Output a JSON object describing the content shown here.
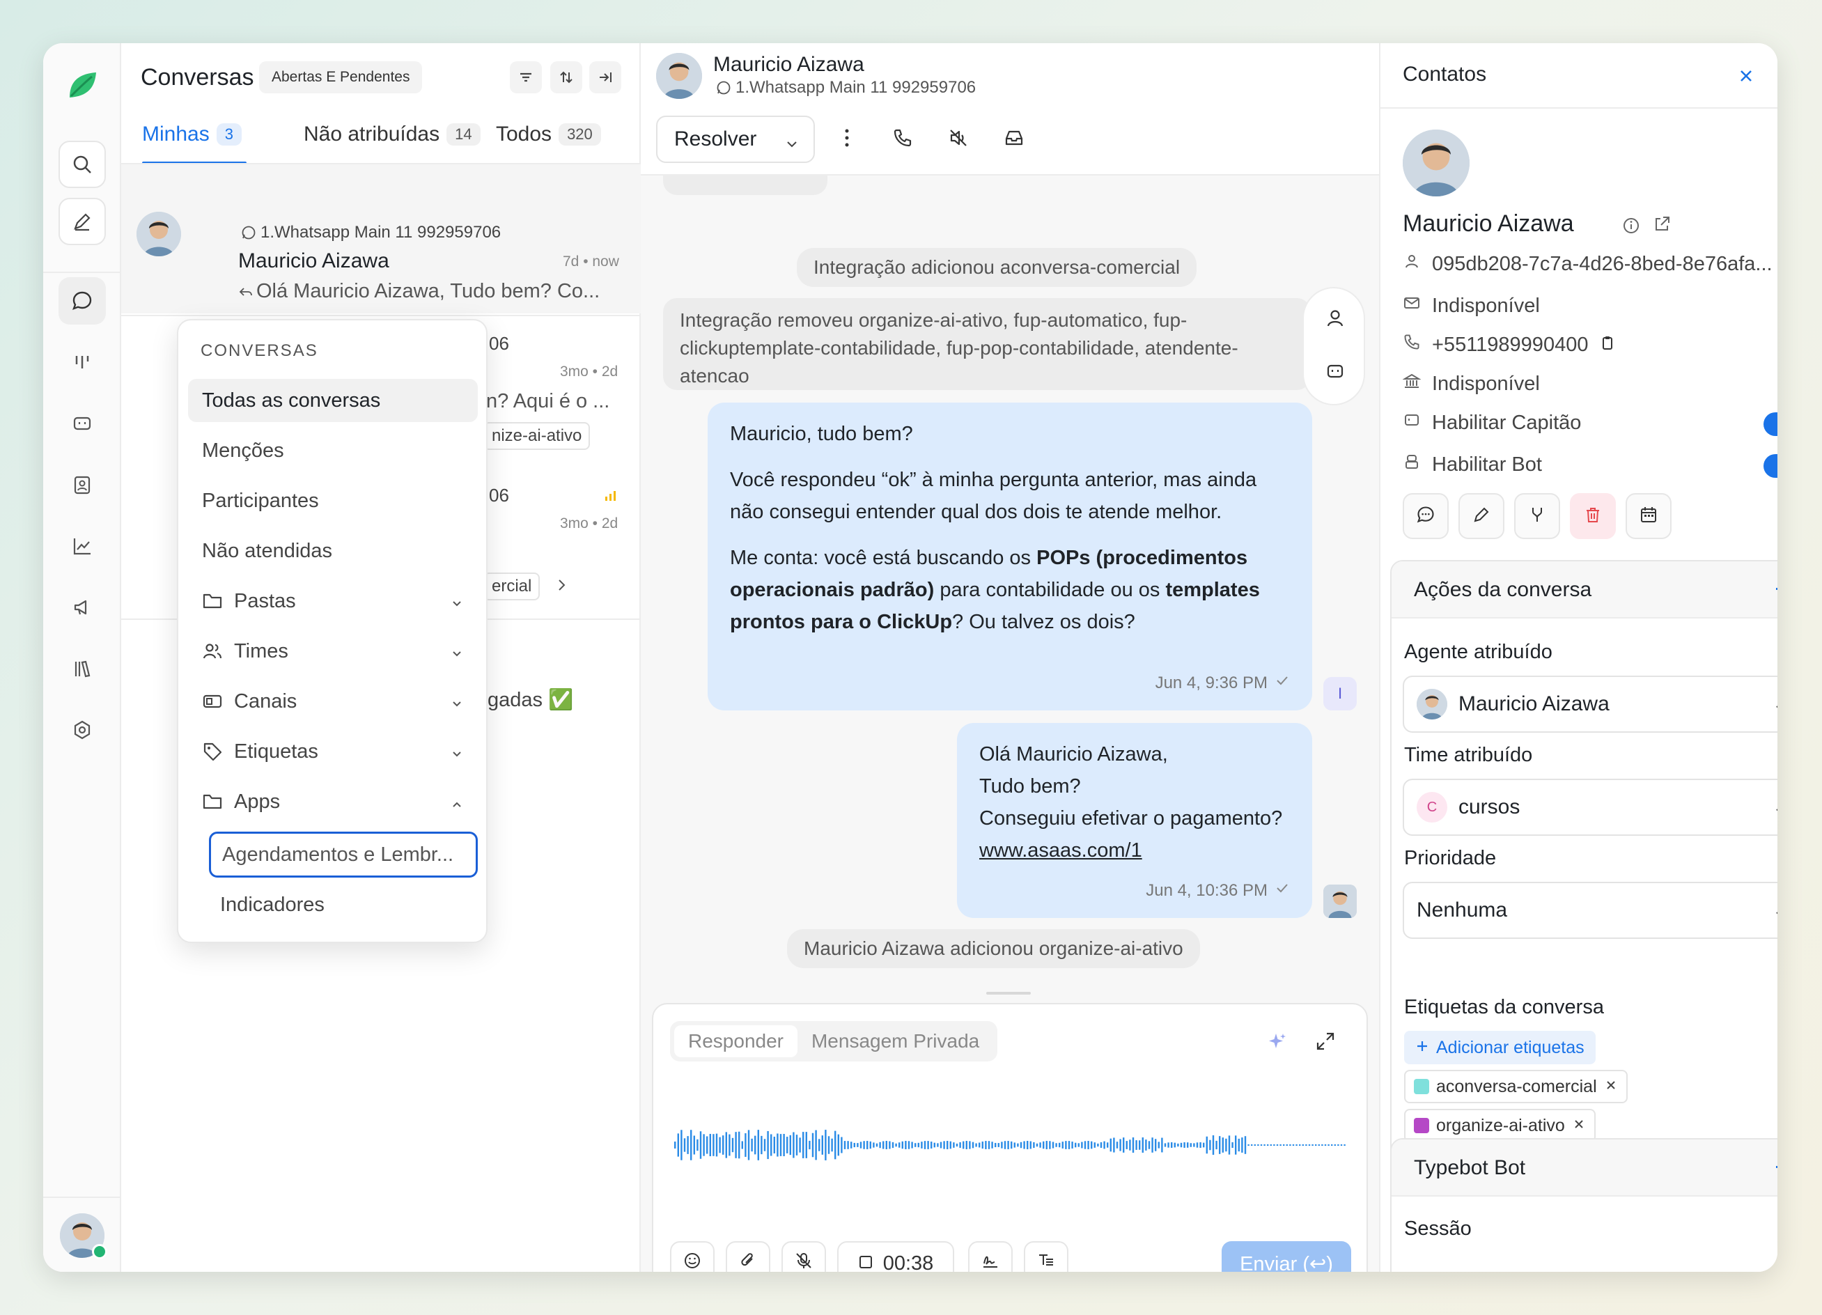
{
  "sidebar": {
    "icons": [
      "logo-leaf-icon",
      "search-icon",
      "compose-icon",
      "chat-icon",
      "kanban-icon",
      "bot-icon",
      "contacts-icon",
      "reports-icon",
      "campaigns-icon",
      "library-icon",
      "settings-icon"
    ]
  },
  "list": {
    "title": "Conversas",
    "status_filter": "Abertas E Pendentes",
    "tabs": [
      {
        "label": "Minhas",
        "count": "3"
      },
      {
        "label": "Não atribuídas",
        "count": "14"
      },
      {
        "label": "Todos",
        "count": "320"
      }
    ],
    "first": {
      "channel": "1.Whatsapp Main 11 992959706",
      "name": "Mauricio Aizawa",
      "time": "7d • now",
      "preview": "Olá Mauricio Aizawa, Tudo bem? Co..."
    },
    "second": {
      "channel_tail": "06",
      "time": "3mo • 2d",
      "preview_tail": "n? Aqui é o ...",
      "tag_tail": "nize-ai-ativo"
    },
    "third": {
      "channel_tail": "06",
      "time": "3mo • 2d",
      "tag_tail": "ercial"
    },
    "fourth": {
      "preview_tail": "gadas ✅"
    }
  },
  "menu": {
    "header": "CONVERSAS",
    "items": [
      {
        "label": "Todas as conversas"
      },
      {
        "label": "Menções"
      },
      {
        "label": "Participantes"
      },
      {
        "label": "Não atendidas"
      },
      {
        "label": "Pastas"
      },
      {
        "label": "Times"
      },
      {
        "label": "Canais"
      },
      {
        "label": "Etiquetas"
      },
      {
        "label": "Apps"
      },
      {
        "label": "Agendamentos e Lembr..."
      },
      {
        "label": "Indicadores"
      }
    ]
  },
  "chat": {
    "name": "Mauricio Aizawa",
    "channel": "1.Whatsapp Main 11 992959706",
    "resolve_label": "Resolver",
    "sys1": "Integração adicionou aconversa-comercial",
    "sys2": "Integração removeu organize-ai-ativo, fup-automatico, fup-clickuptemplate-contabilidade, fup-pop-contabilidade, atendente-atencao",
    "msg1": {
      "p1": "Mauricio, tudo bem?",
      "p2": "Você respondeu “ok” à minha pergunta anterior, mas ainda não consegui entender qual dos dois te atende melhor.",
      "p3_a": "Me conta: você está buscando os ",
      "p3_b": "POPs (procedimentos operacionais padrão)",
      "p3_c": " para contabilidade ou os ",
      "p3_d": "templates prontos para o ClickUp",
      "p3_e": "? Ou talvez os dois?",
      "time": "Jun 4, 9:36 PM",
      "avatar_initial": "I"
    },
    "msg2": {
      "l1": "Olá Mauricio Aizawa,",
      "l2": "Tudo bem?",
      "l3": "Conseguiu efetivar o pagamento?",
      "link": "www.asaas.com/1",
      "time": "Jun 4, 10:36 PM"
    },
    "sys3": "Mauricio Aizawa adicionou organize-ai-ativo",
    "composer": {
      "tab_reply": "Responder",
      "tab_private": "Mensagem Privada",
      "timer": "00:38",
      "send": "Enviar (↩)"
    }
  },
  "contacts": {
    "title": "Contatos",
    "name": "Mauricio Aizawa",
    "id": "095db208-7c7a-4d26-8bed-8e76afa...",
    "email": "Indisponível",
    "phone": "+5511989990400",
    "company": "Indisponível",
    "toggle1": "Habilitar Capitão",
    "toggle2": "Habilitar Bot",
    "actions_title": "Ações da conversa",
    "agent_label": "Agente atribuído",
    "agent_value": "Mauricio Aizawa",
    "team_label": "Time atribuído",
    "team_initial": "C",
    "team_value": "cursos",
    "priority_label": "Prioridade",
    "priority_value": "Nenhuma",
    "tags_label": "Etiquetas da conversa",
    "add_tags": "Adicionar etiquetas",
    "tags": [
      {
        "label": "aconversa-comercial",
        "color": "#7fe0dc"
      },
      {
        "label": "organize-ai-ativo",
        "color": "#b548c6"
      }
    ],
    "typebot_title": "Typebot Bot",
    "session_label": "Sessão"
  },
  "colors": {
    "accent": "#1a73e8",
    "bubble": "#dcebfd",
    "send_disabled": "#9cc2f5",
    "danger": "#e5484d"
  }
}
